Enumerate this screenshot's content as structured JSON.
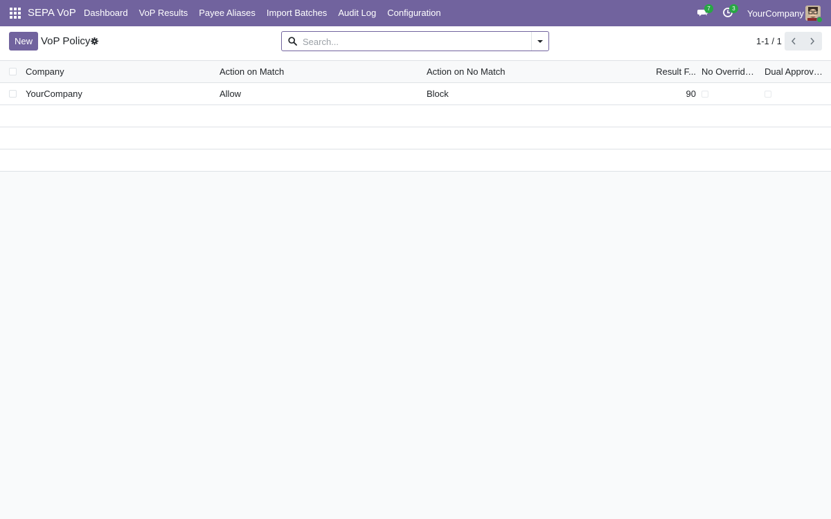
{
  "navbar": {
    "apps_icon": "apps-grid-icon",
    "brand": "SEPA VoP",
    "menu": [
      "Dashboard",
      "VoP Results",
      "Payee Aliases",
      "Import Batches",
      "Audit Log",
      "Configuration"
    ],
    "messages_badge": "7",
    "activities_badge": "3",
    "company": "YourCompany",
    "accent_color": "#71639e"
  },
  "control_panel": {
    "new_label": "New",
    "title": "VoP Policy",
    "gear_icon": "gear-icon",
    "search_placeholder": "Search...",
    "pager": "1-1 / 1"
  },
  "list": {
    "columns": [
      "Company",
      "Action on Match",
      "Action on No Match",
      "Result F...",
      "No Override ...",
      "Dual Approva..."
    ],
    "rows": [
      {
        "company": "YourCompany",
        "action_on_match": "Allow",
        "action_on_no_match": "Block",
        "result_f": "90",
        "no_override": false,
        "dual_approval": false
      }
    ]
  }
}
